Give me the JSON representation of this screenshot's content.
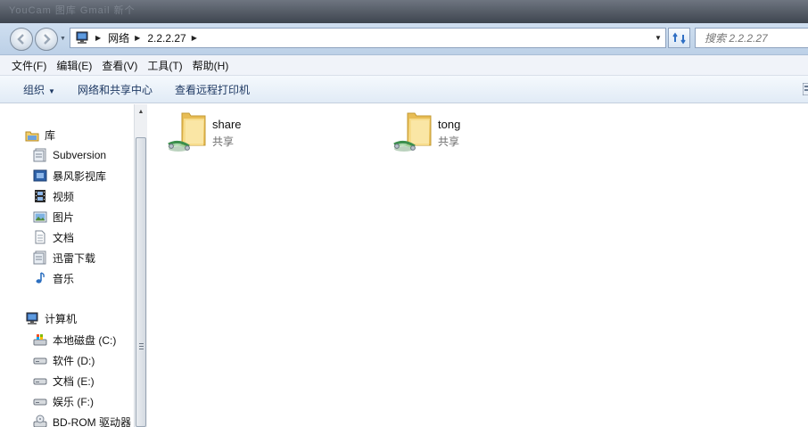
{
  "titlebar": {
    "blurred_text": "YouCam  图库  Gmail  新个"
  },
  "nav": {
    "back_icon": "back-arrow-icon",
    "forward_icon": "forward-arrow-icon",
    "breadcrumb": [
      "网络",
      "2.2.2.27"
    ],
    "search_placeholder": "搜索 2.2.2.27"
  },
  "menu": [
    "文件(F)",
    "编辑(E)",
    "查看(V)",
    "工具(T)",
    "帮助(H)"
  ],
  "toolbar": {
    "organize": "组织",
    "network_center": "网络和共享中心",
    "printers": "查看远程打印机"
  },
  "sidebar": {
    "library": {
      "label": "库",
      "items": [
        "Subversion",
        "暴风影视库",
        "视频",
        "图片",
        "文档",
        "迅雷下载",
        "音乐"
      ]
    },
    "computer": {
      "label": "计算机",
      "items": [
        "本地磁盘 (C:)",
        "软件 (D:)",
        "文档 (E:)",
        "娱乐 (F:)",
        "BD-ROM 驱动器"
      ]
    }
  },
  "shares": [
    {
      "name": "share",
      "type": "共享"
    },
    {
      "name": "tong",
      "type": "共享"
    }
  ],
  "colors": {
    "accent": "#1e3963",
    "nav_bg": "#c7d9ed",
    "folder": "#f2d27a"
  }
}
